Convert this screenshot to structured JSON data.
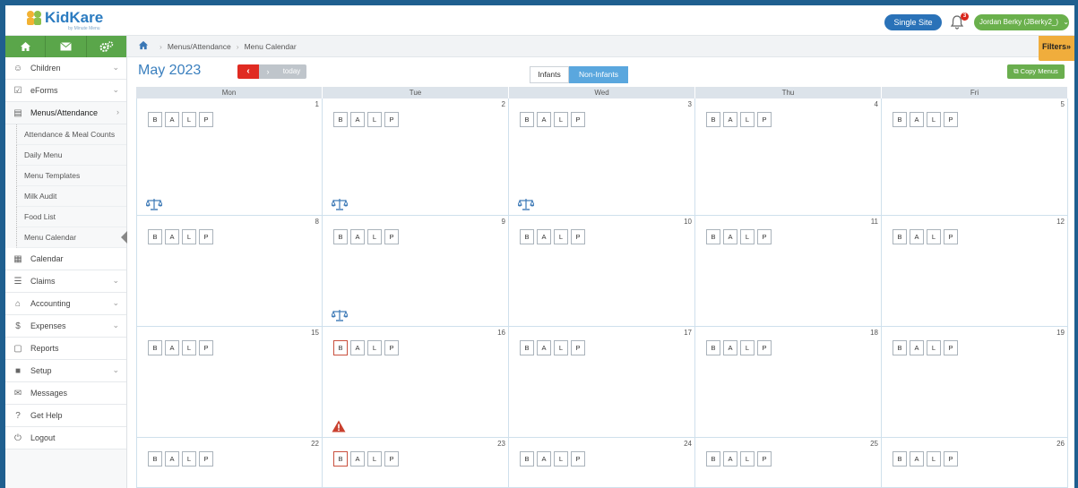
{
  "header": {
    "logo_text": "KidKare",
    "logo_sub": "by Minute Menu",
    "single_site_label": "Single Site",
    "notification_count": "3",
    "user_label": "Jordan Berky (JBerky2_)"
  },
  "sidebar": {
    "items": [
      {
        "label": "Children",
        "icon": "child-icon",
        "chevron": true
      },
      {
        "label": "eForms",
        "icon": "checkbox-icon",
        "chevron": true
      },
      {
        "label": "Menus/Attendance",
        "icon": "clipboard-icon",
        "chevron": true
      },
      {
        "label": "Calendar",
        "icon": "calendar-icon",
        "chevron": false
      },
      {
        "label": "Claims",
        "icon": "claims-icon",
        "chevron": true
      },
      {
        "label": "Accounting",
        "icon": "bank-icon",
        "chevron": true
      },
      {
        "label": "Expenses",
        "icon": "dollar-icon",
        "chevron": true
      },
      {
        "label": "Reports",
        "icon": "report-icon",
        "chevron": false
      },
      {
        "label": "Setup",
        "icon": "briefcase-icon",
        "chevron": true
      },
      {
        "label": "Messages",
        "icon": "envelope-icon",
        "chevron": false
      },
      {
        "label": "Get Help",
        "icon": "help-icon",
        "chevron": false
      },
      {
        "label": "Logout",
        "icon": "power-icon",
        "chevron": false
      }
    ],
    "subitems": [
      "Attendance & Meal Counts",
      "Daily Menu",
      "Menu Templates",
      "Milk Audit",
      "Food List",
      "Menu Calendar"
    ]
  },
  "breadcrumb": {
    "section": "Menus/Attendance",
    "page": "Menu Calendar",
    "filters_label": "Filters"
  },
  "calendar": {
    "month": "May 2023",
    "today_label": "today",
    "tab_infants": "Infants",
    "tab_noninfants": "Non-Infants",
    "copy_label": "Copy Menus",
    "days": [
      "Mon",
      "Tue",
      "Wed",
      "Thu",
      "Fri"
    ],
    "meal_labels": [
      "B",
      "A",
      "L",
      "P"
    ],
    "weeks": [
      [
        {
          "d": "1",
          "icon": "scale"
        },
        {
          "d": "2",
          "icon": "scale"
        },
        {
          "d": "3",
          "icon": "scale"
        },
        {
          "d": "4"
        },
        {
          "d": "5"
        }
      ],
      [
        {
          "d": "8"
        },
        {
          "d": "9",
          "icon": "scale"
        },
        {
          "d": "10"
        },
        {
          "d": "11"
        },
        {
          "d": "12"
        }
      ],
      [
        {
          "d": "15"
        },
        {
          "d": "16",
          "icon": "warning",
          "flag": true
        },
        {
          "d": "17"
        },
        {
          "d": "18"
        },
        {
          "d": "19"
        }
      ],
      [
        {
          "d": "22"
        },
        {
          "d": "23",
          "flag": true
        },
        {
          "d": "24"
        },
        {
          "d": "25"
        },
        {
          "d": "26"
        }
      ]
    ]
  }
}
